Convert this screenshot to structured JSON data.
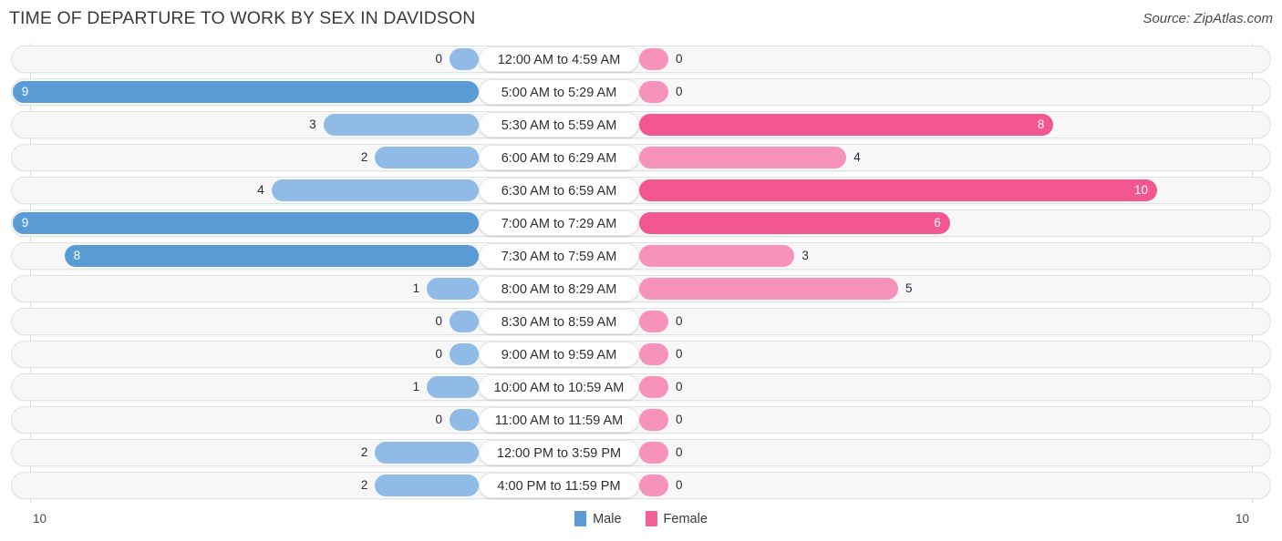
{
  "header": {
    "title": "TIME OF DEPARTURE TO WORK BY SEX IN DAVIDSON",
    "source": "Source: ZipAtlas.com"
  },
  "axis": {
    "left_max_label": "10",
    "right_max_label": "10"
  },
  "legend": {
    "items": [
      {
        "label": "Male",
        "color": "#5b9bd5"
      },
      {
        "label": "Female",
        "color": "#f2609a"
      }
    ]
  },
  "colors": {
    "male_light": "#8fbbe6",
    "male_dark": "#5b9bd5",
    "female_light": "#f793bb",
    "female_dark": "#f2578f",
    "track_fill": "#f7f7f7",
    "track_border": "#e2e2e2",
    "label_pill": "#ffffff"
  },
  "chart_data": {
    "type": "bar",
    "title": "TIME OF DEPARTURE TO WORK BY SEX IN DAVIDSON",
    "orientation": "horizontal-diverging",
    "xlabel": "",
    "ylabel": "",
    "xlim": [
      10,
      10
    ],
    "grid": false,
    "legend_position": "bottom-center",
    "categories": [
      "12:00 AM to 4:59 AM",
      "5:00 AM to 5:29 AM",
      "5:30 AM to 5:59 AM",
      "6:00 AM to 6:29 AM",
      "6:30 AM to 6:59 AM",
      "7:00 AM to 7:29 AM",
      "7:30 AM to 7:59 AM",
      "8:00 AM to 8:29 AM",
      "8:30 AM to 8:59 AM",
      "9:00 AM to 9:59 AM",
      "10:00 AM to 10:59 AM",
      "11:00 AM to 11:59 AM",
      "12:00 PM to 3:59 PM",
      "4:00 PM to 11:59 PM"
    ],
    "series": [
      {
        "name": "Male",
        "values": [
          0,
          9,
          3,
          2,
          4,
          9,
          8,
          1,
          0,
          0,
          1,
          0,
          2,
          2
        ]
      },
      {
        "name": "Female",
        "values": [
          0,
          0,
          8,
          4,
          10,
          6,
          3,
          5,
          0,
          0,
          0,
          0,
          0,
          0
        ]
      }
    ]
  }
}
